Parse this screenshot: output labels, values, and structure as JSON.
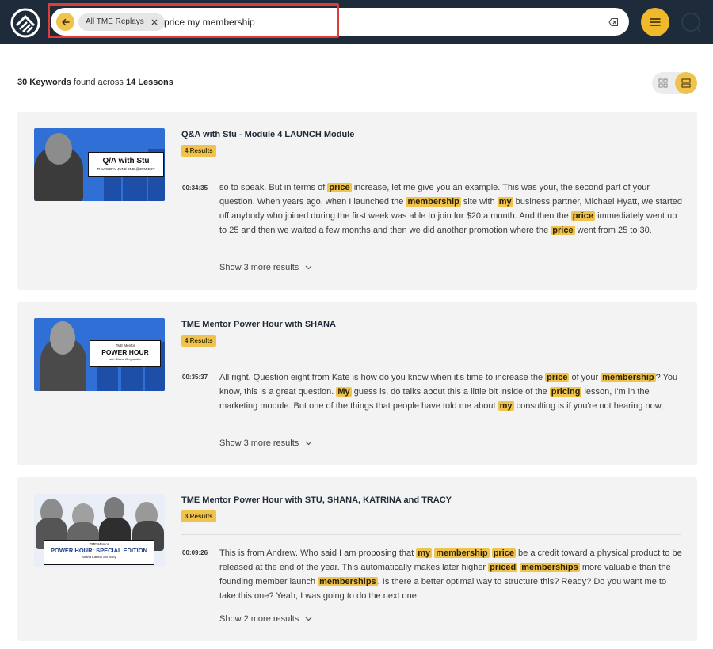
{
  "search": {
    "scope_chip": "All TME Replays",
    "query": "price my membership"
  },
  "summary": {
    "keyword_count": "30 Keywords",
    "found_text": " found across ",
    "lesson_count": "14 Lessons"
  },
  "colors": {
    "topbar": "#1d2b3a",
    "accent": "#f0c34f",
    "highlight_box": "#e03b3b",
    "card_bg": "#f3f3f3"
  },
  "results": [
    {
      "title": "Q&A with Stu - Module 4 LAUNCH Module",
      "badge": "4 Results",
      "thumb_title": "Q/A with Stu",
      "thumb_sub": "THURSDAY JUNE 2ND @3PM EDT",
      "timestamp": "00:34:35",
      "snippet": [
        {
          "t": "so to speak. But in terms of "
        },
        {
          "h": "price"
        },
        {
          "t": " increase, let me give you an example. This was your, the second part of your question. When years ago, when I launched the "
        },
        {
          "h": "membership"
        },
        {
          "t": " site with "
        },
        {
          "h": "my"
        },
        {
          "t": " business partner, Michael Hyatt, we started off anybody who joined during the first week was able to join for $20 a month. And then the "
        },
        {
          "h": "price"
        },
        {
          "t": " immediately went up to 25 and then we waited a few months and then we did another promotion where the "
        },
        {
          "h": "price"
        },
        {
          "t": " went from 25 to 30."
        }
      ],
      "more": "Show 3 more results"
    },
    {
      "title": "TME Mentor Power Hour with SHANA",
      "badge": "4 Results",
      "thumb_title": "POWER HOUR",
      "thumb_pre": "TME Mentor",
      "thumb_sub": "with Shana Bergandine",
      "timestamp": "00:35:37",
      "snippet": [
        {
          "t": "All right. Question eight from Kate is how do you know when it's time to increase the "
        },
        {
          "h": "price"
        },
        {
          "t": " of your "
        },
        {
          "h": "membership"
        },
        {
          "t": "? You know, this is a great question. "
        },
        {
          "h": "My"
        },
        {
          "t": " guess is, do talks about this a little bit inside of the "
        },
        {
          "h": "pricing"
        },
        {
          "t": " lesson, I'm in the marketing module. But one of the things that people have told me about "
        },
        {
          "h": "my"
        },
        {
          "t": " consulting is if you're not hearing now,"
        }
      ],
      "more": "Show 3 more results"
    },
    {
      "title": "TME Mentor Power Hour with STU, SHANA, KATRINA and TRACY",
      "badge": "3 Results",
      "thumb_title": "POWER HOUR: SPECIAL EDITION",
      "thumb_pre": "TME Mentor",
      "thumb_sub": "Shana Katrina Stu Tracy",
      "timestamp": "00:09:26",
      "snippet": [
        {
          "t": "This is from Andrew. Who said I am proposing that "
        },
        {
          "h": "my"
        },
        {
          "t": " "
        },
        {
          "h": "membership"
        },
        {
          "t": " "
        },
        {
          "h": "price"
        },
        {
          "t": " be a credit toward a physical product to be released at the end of the year. This automatically makes later higher "
        },
        {
          "h": "priced"
        },
        {
          "t": " "
        },
        {
          "h": "memberships"
        },
        {
          "t": " more valuable than the founding member launch "
        },
        {
          "h": "memberships"
        },
        {
          "t": ". Is there a better optimal way to structure this? Ready? Do you want me to take this one? Yeah, I was going to do the next one."
        }
      ],
      "more": "Show 2 more results"
    }
  ]
}
